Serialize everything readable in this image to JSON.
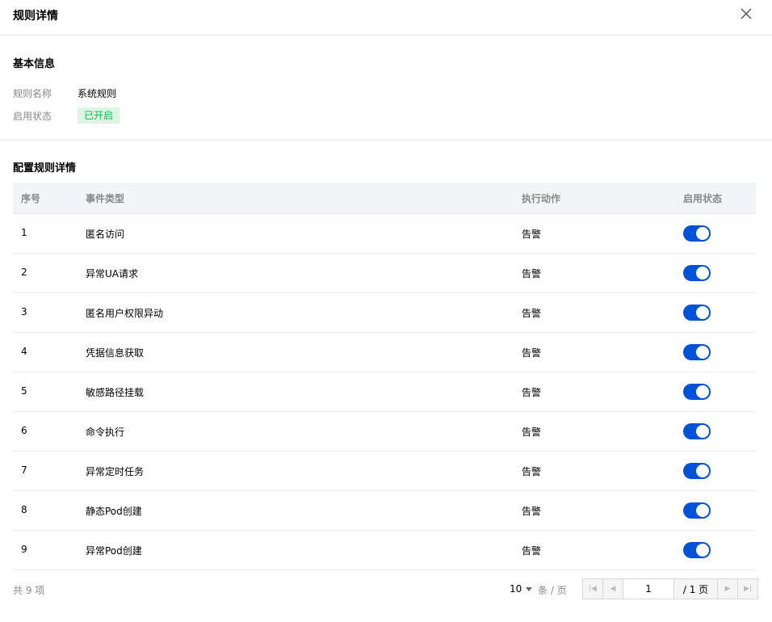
{
  "header": {
    "title": "规则详情"
  },
  "basic": {
    "section_title": "基本信息",
    "name_label": "规则名称",
    "name_value": "系统规则",
    "status_label": "启用状态",
    "status_value": "已开启",
    "status_color": "#0abf5b"
  },
  "config": {
    "section_title": "配置规则详情",
    "columns": [
      "序号",
      "事件类型",
      "执行动作",
      "启用状态"
    ],
    "rows": [
      {
        "no": "1",
        "event": "匿名访问",
        "action": "告警",
        "enabled": true
      },
      {
        "no": "2",
        "event": "异常UA请求",
        "action": "告警",
        "enabled": true
      },
      {
        "no": "3",
        "event": "匿名用户权限异动",
        "action": "告警",
        "enabled": true
      },
      {
        "no": "4",
        "event": "凭据信息获取",
        "action": "告警",
        "enabled": true
      },
      {
        "no": "5",
        "event": "敏感路径挂载",
        "action": "告警",
        "enabled": true
      },
      {
        "no": "6",
        "event": "命令执行",
        "action": "告警",
        "enabled": true
      },
      {
        "no": "7",
        "event": "异常定时任务",
        "action": "告警",
        "enabled": true
      },
      {
        "no": "8",
        "event": "静态Pod创建",
        "action": "告警",
        "enabled": true
      },
      {
        "no": "9",
        "event": "异常Pod创建",
        "action": "告警",
        "enabled": true
      }
    ]
  },
  "pagination": {
    "total_text": "共 9 项",
    "page_size": "10",
    "per_page_text": "条 / 页",
    "current_page": "1",
    "total_pages_text": "/ 1 页"
  },
  "colors": {
    "accent": "#0052d9",
    "header_bg": "#f3f4f7"
  }
}
